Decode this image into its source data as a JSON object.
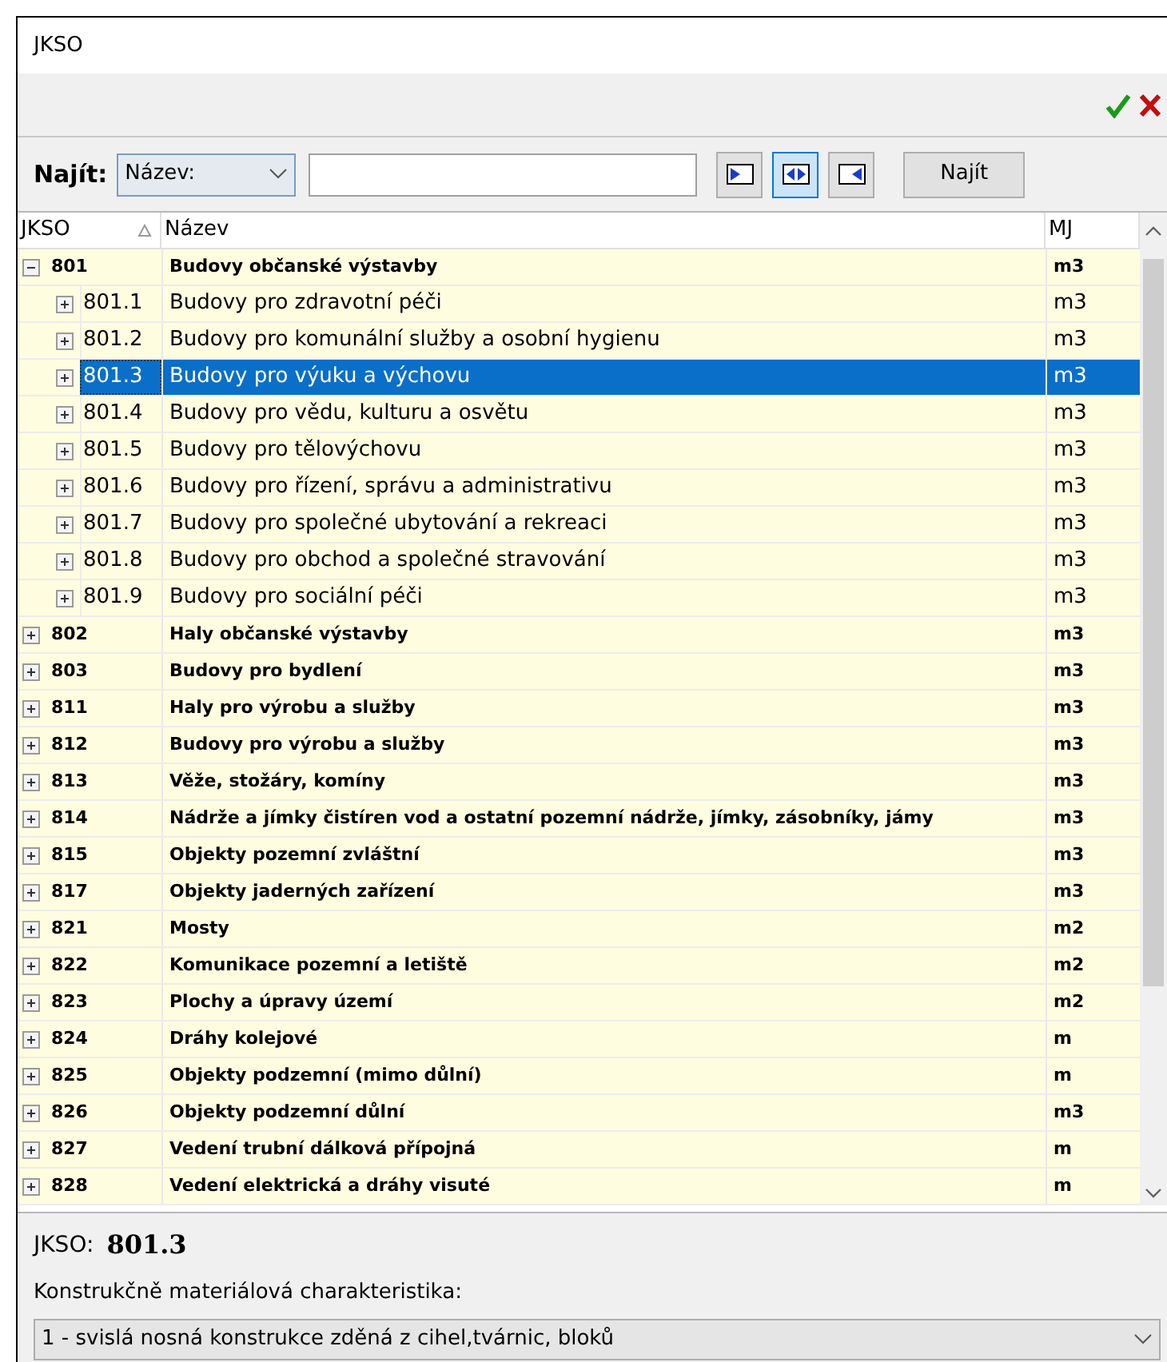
{
  "window": {
    "title": "JKSO"
  },
  "search": {
    "label": "Najít:",
    "field": "Název:",
    "modes": [
      {
        "selected": false
      },
      {
        "selected": true
      },
      {
        "selected": false
      }
    ],
    "button": "Najít"
  },
  "table": {
    "columns": [
      {
        "label": "JKSO",
        "sorted": true
      },
      {
        "label": "Název",
        "sorted": false
      },
      {
        "label": "MJ",
        "sorted": false
      }
    ],
    "rows": [
      {
        "code": "801",
        "name": "Budovy občanské výstavby",
        "unit": "m3",
        "expanded": true,
        "selected": false,
        "children": [
          {
            "code": "801.1",
            "name": "Budovy pro zdravotní péči",
            "unit": "m3",
            "expanded": false,
            "selected": false
          },
          {
            "code": "801.2",
            "name": "Budovy pro komunální služby a osobní hygienu",
            "unit": "m3",
            "expanded": false,
            "selected": false
          },
          {
            "code": "801.3",
            "name": "Budovy pro výuku a výchovu",
            "unit": "m3",
            "expanded": false,
            "selected": true
          },
          {
            "code": "801.4",
            "name": "Budovy pro vědu, kulturu a osvětu",
            "unit": "m3",
            "expanded": false,
            "selected": false
          },
          {
            "code": "801.5",
            "name": "Budovy pro tělovýchovu",
            "unit": "m3",
            "expanded": false,
            "selected": false
          },
          {
            "code": "801.6",
            "name": "Budovy pro řízení, správu a administrativu",
            "unit": "m3",
            "expanded": false,
            "selected": false
          },
          {
            "code": "801.7",
            "name": "Budovy pro společné ubytování a rekreaci",
            "unit": "m3",
            "expanded": false,
            "selected": false
          },
          {
            "code": "801.8",
            "name": "Budovy pro obchod a společné stravování",
            "unit": "m3",
            "expanded": false,
            "selected": false
          },
          {
            "code": "801.9",
            "name": "Budovy pro sociální péči",
            "unit": "m3",
            "expanded": false,
            "selected": false
          }
        ]
      },
      {
        "code": "802",
        "name": "Haly občanské výstavby",
        "unit": "m3",
        "expanded": false,
        "selected": false
      },
      {
        "code": "803",
        "name": "Budovy pro bydlení",
        "unit": "m3",
        "expanded": false,
        "selected": false
      },
      {
        "code": "811",
        "name": "Haly pro výrobu a služby",
        "unit": "m3",
        "expanded": false,
        "selected": false
      },
      {
        "code": "812",
        "name": "Budovy pro výrobu a služby",
        "unit": "m3",
        "expanded": false,
        "selected": false
      },
      {
        "code": "813",
        "name": "Věže, stožáry, komíny",
        "unit": "m3",
        "expanded": false,
        "selected": false
      },
      {
        "code": "814",
        "name": "Nádrže a jímky čistíren vod a ostatní pozemní nádrže, jímky, zásobníky, jámy",
        "unit": "m3",
        "expanded": false,
        "selected": false
      },
      {
        "code": "815",
        "name": "Objekty pozemní zvláštní",
        "unit": "m3",
        "expanded": false,
        "selected": false
      },
      {
        "code": "817",
        "name": "Objekty jaderných zařízení",
        "unit": "m3",
        "expanded": false,
        "selected": false
      },
      {
        "code": "821",
        "name": "Mosty",
        "unit": "m2",
        "expanded": false,
        "selected": false
      },
      {
        "code": "822",
        "name": "Komunikace pozemní a letiště",
        "unit": "m2",
        "expanded": false,
        "selected": false
      },
      {
        "code": "823",
        "name": "Plochy a úpravy území",
        "unit": "m2",
        "expanded": false,
        "selected": false
      },
      {
        "code": "824",
        "name": "Dráhy kolejové",
        "unit": "m",
        "expanded": false,
        "selected": false
      },
      {
        "code": "825",
        "name": "Objekty podzemní (mimo důlní)",
        "unit": "m",
        "expanded": false,
        "selected": false
      },
      {
        "code": "826",
        "name": "Objekty podzemní důlní",
        "unit": "m3",
        "expanded": false,
        "selected": false
      },
      {
        "code": "827",
        "name": "Vedení trubní dálková  přípojná",
        "unit": "m",
        "expanded": false,
        "selected": false
      },
      {
        "code": "828",
        "name": "Vedení elektrická a dráhy visuté",
        "unit": "m",
        "expanded": false,
        "selected": false
      }
    ]
  },
  "details": {
    "jkso_label": "JKSO:",
    "jkso_value": "801.3",
    "characteristic_label": "Konstrukčně materiálová charakteristika:",
    "characteristic_value": "1 - svislá nosná konstrukce zděná z cihel,tvárnic, bloků"
  }
}
